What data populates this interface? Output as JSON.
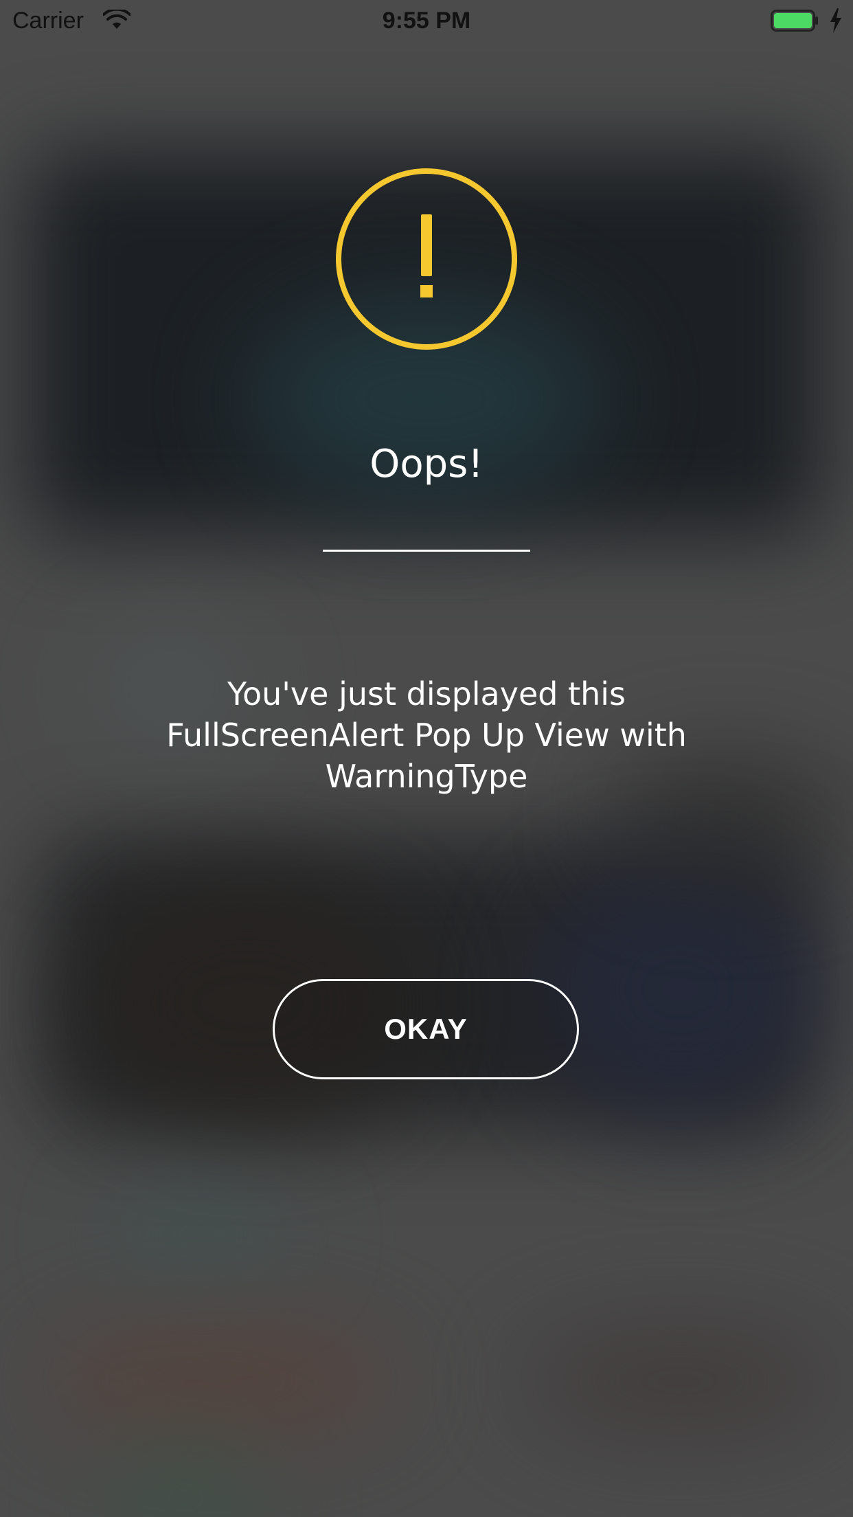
{
  "status_bar": {
    "carrier": "Carrier",
    "time": "9:55 PM",
    "wifi_icon": "wifi-icon",
    "battery_icon": "battery-charging-icon",
    "battery_color": "#4cd964"
  },
  "alert": {
    "icon": "warning-circle-icon",
    "icon_color": "#f5c830",
    "title": "Oops!",
    "message": "You've just displayed this FullScreenAlert Pop Up View with WarningType",
    "button_label": "OKAY"
  }
}
